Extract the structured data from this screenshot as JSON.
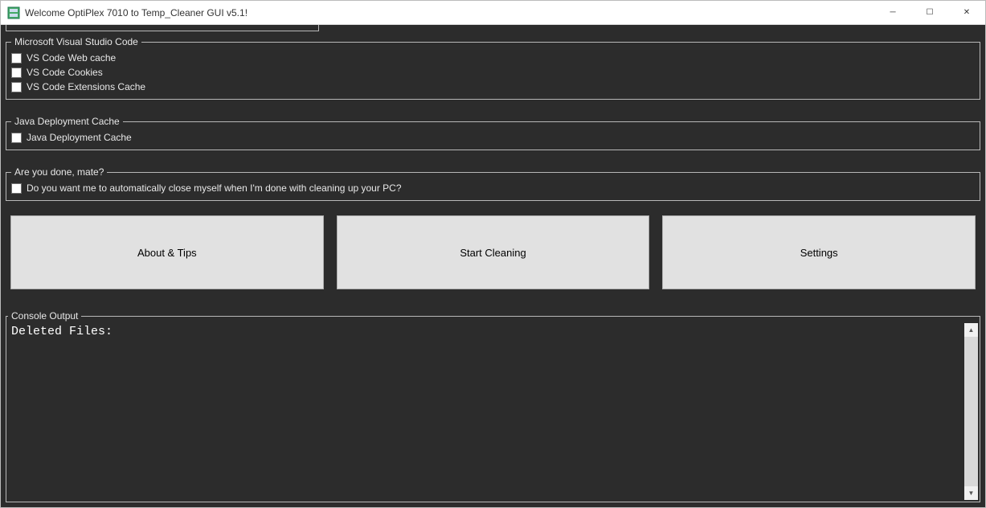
{
  "window": {
    "title": "Welcome OptiPlex 7010 to Temp_Cleaner GUI v5.1!",
    "min_glyph": "─",
    "max_glyph": "☐",
    "close_glyph": "✕"
  },
  "groups": {
    "vscode": {
      "legend": "Microsoft Visual Studio Code",
      "items": [
        {
          "label": "VS Code Web cache",
          "checked": false
        },
        {
          "label": "VS Code Cookies",
          "checked": false
        },
        {
          "label": "VS Code Extensions Cache",
          "checked": false
        }
      ]
    },
    "java": {
      "legend": "Java Deployment Cache",
      "items": [
        {
          "label": "Java Deployment Cache",
          "checked": false
        }
      ]
    },
    "done": {
      "legend": "Are you done, mate?",
      "items": [
        {
          "label": "Do you want me to automatically close myself when I'm done with cleaning up your PC?",
          "checked": false
        }
      ]
    }
  },
  "buttons": {
    "about": "About & Tips",
    "start": "Start Cleaning",
    "settings": "Settings"
  },
  "console": {
    "legend": "Console Output",
    "text": "Deleted Files:"
  },
  "scrollbar": {
    "up": "▲",
    "down": "▼"
  }
}
